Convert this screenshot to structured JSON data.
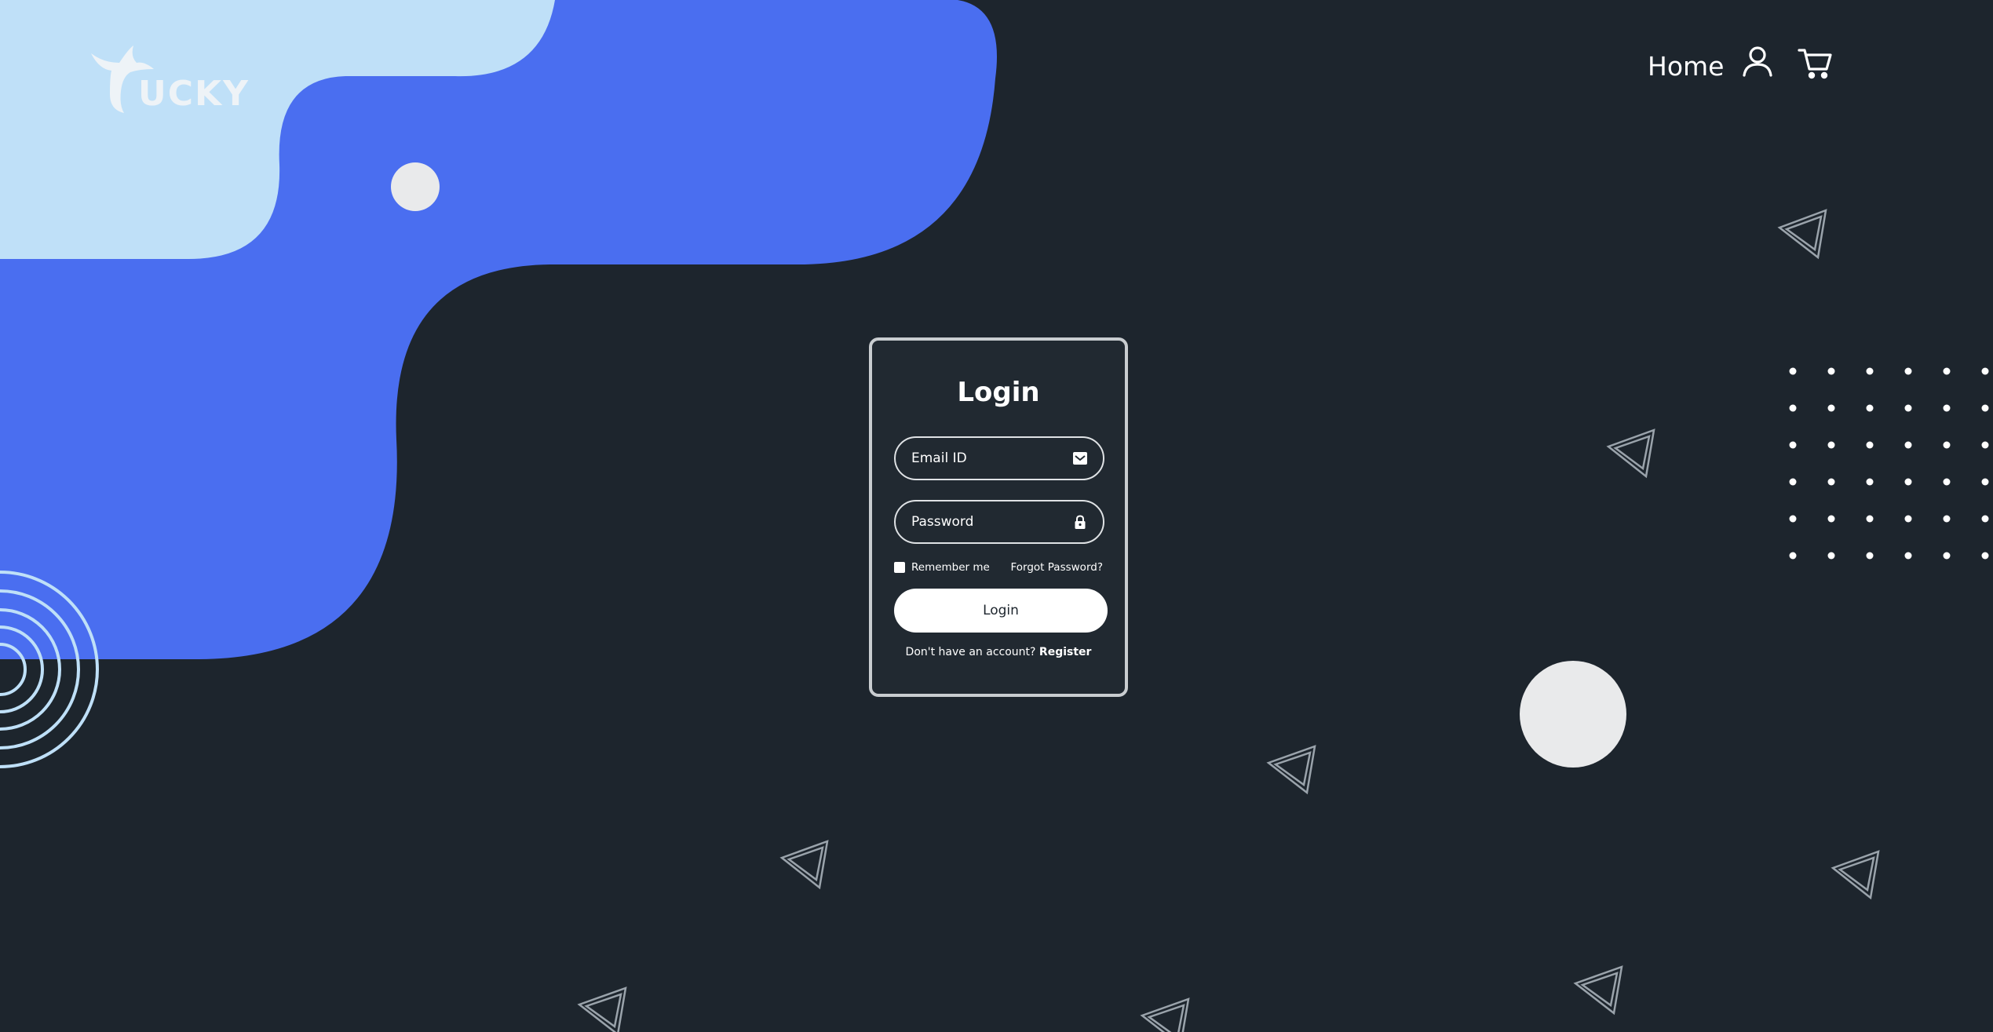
{
  "brand": {
    "logo_text": "UCKY",
    "logo_alt": "Tucky"
  },
  "nav": {
    "home_label": "Home",
    "user_icon": "user-icon",
    "cart_icon": "cart-icon"
  },
  "login": {
    "title": "Login",
    "email_placeholder": "Email ID",
    "email_value": "",
    "email_icon": "envelope-icon",
    "password_placeholder": "Password",
    "password_value": "",
    "password_icon": "lock-icon",
    "remember_label": "Remember me",
    "remember_checked": false,
    "forgot_label": "Forgot Password?",
    "submit_label": "Login",
    "register_prompt": "Don't have an account?",
    "register_label": "Register"
  },
  "colors": {
    "background": "#1d252d",
    "light_blue": "#bfe0f8",
    "royal_blue": "#4a6ef0",
    "ring": "#bfe0f8",
    "circle": "#e9eaeb",
    "card_border": "#c9cdd0",
    "button": "#ffffff"
  }
}
